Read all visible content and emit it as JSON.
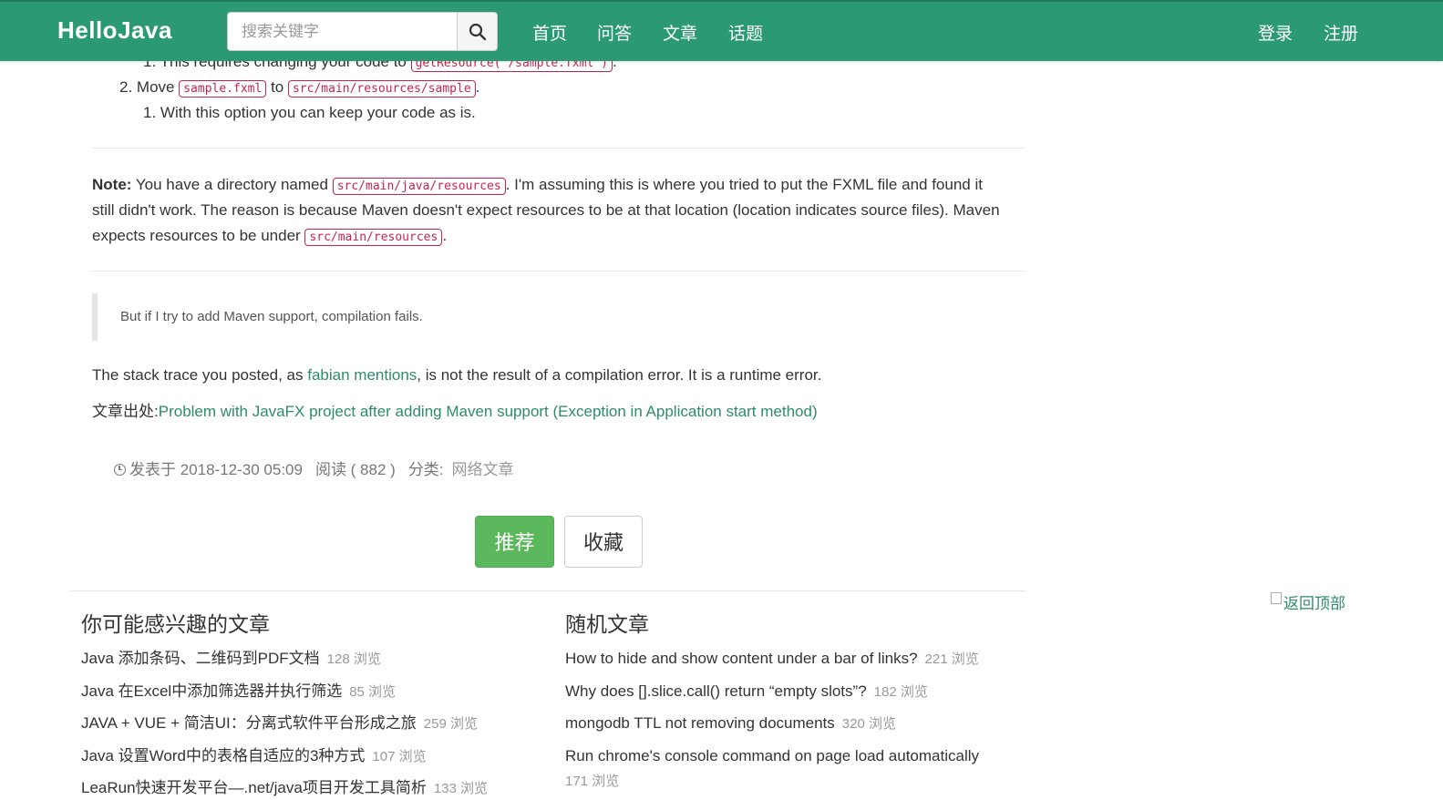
{
  "navbar": {
    "brand": "HelloJava",
    "search_placeholder": "搜索关键字",
    "links": [
      "首页",
      "问答",
      "文章",
      "话题"
    ],
    "login": "登录",
    "register": "注册"
  },
  "article": {
    "list_top": {
      "num": "1.",
      "text_before": "This requires changing your code to",
      "code": "getResource(\"/sample.fxml\")",
      "text_after": "."
    },
    "list_item2": {
      "num": "2.",
      "text_before": "Move",
      "code1": "sample.fxml",
      "middle": "to",
      "code2": "src/main/resources/sample",
      "text_after": "."
    },
    "list_item2_sub": {
      "num": "1.",
      "text": "With this option you can keep your code as is."
    },
    "note": {
      "label": "Note:",
      "line1_before": "You have a directory named",
      "line1_code": "src/main/java/resources",
      "line1_after": ". I'm assuming this is where you tried to put the FXML file and found it",
      "line2": "still didn't work. The reason is because Maven doesn't expect resources to be at that location (location indicates source files). Maven",
      "line3_before": "expects resources to be under",
      "line3_code": "src/main/resources",
      "line3_after": "."
    },
    "quote": "But if I try to add Maven support, compilation fails.",
    "stack": {
      "before": "The stack trace you posted, as",
      "link": "fabian mentions",
      "after": ", is not the result of a compilation error. It is a runtime error."
    },
    "source": {
      "label": "文章出处:",
      "link": "Problem with JavaFX project after adding Maven support (Exception in Application start method)"
    }
  },
  "meta": {
    "clock_icon": "clock-icon",
    "published": "发表于 2018-12-30 05:09",
    "reads": "阅读 ( 882 )",
    "category_label": "分类:",
    "category": "网络文章"
  },
  "buttons": {
    "recommend": "推荐",
    "favorite": "收藏"
  },
  "related": {
    "title": "你可能感兴趣的文章",
    "items": [
      {
        "title": "Java 添加条码、二维码到PDF文档",
        "views": "128 浏览"
      },
      {
        "title": "Java 在Excel中添加筛选器并执行筛选",
        "views": "85 浏览"
      },
      {
        "title": "JAVA + VUE + 简洁UI：分离式软件平台形成之旅",
        "views": "259 浏览"
      },
      {
        "title": "Java 设置Word中的表格自适应的3种方式",
        "views": "107 浏览"
      },
      {
        "title": "LeaRun快速开发平台—.net/java项目开发工具简析",
        "views": "133 浏览"
      }
    ]
  },
  "random": {
    "title": "随机文章",
    "items": [
      {
        "title": "How to hide and show content under a bar of links?",
        "views": "221 浏览"
      },
      {
        "title": "Why does [].slice.call() return “empty slots”?",
        "views": "182 浏览"
      },
      {
        "title": "mongodb TTL not removing documents",
        "views": "320 浏览"
      },
      {
        "title": "Run chrome's console command on page load automatically",
        "views": "171 浏览"
      }
    ]
  },
  "back_to_top": "返回顶部",
  "colors": {
    "navbar": "#2b9a74",
    "link": "#2e8b6b",
    "code": "#c7254e",
    "recommend": "#5cb85c"
  }
}
